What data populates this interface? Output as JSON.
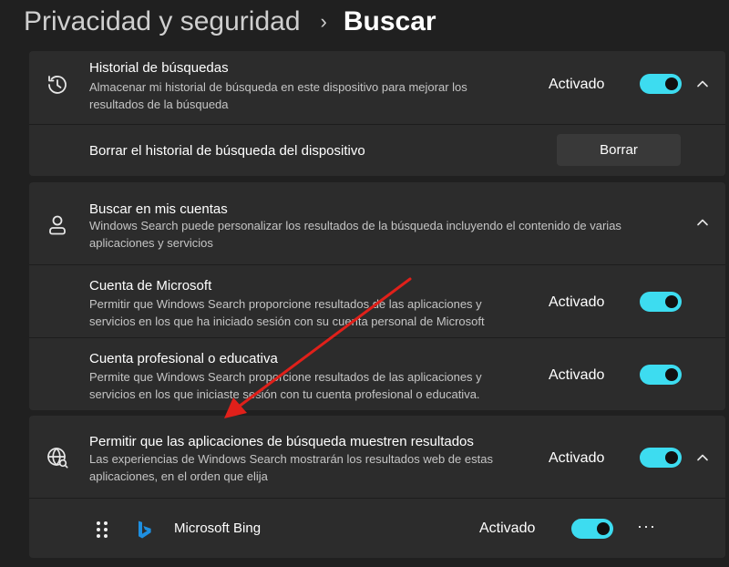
{
  "breadcrumb": {
    "parent": "Privacidad y seguridad",
    "separator": "›",
    "current": "Buscar"
  },
  "history": {
    "title": "Historial de búsquedas",
    "description": "Almacenar mi historial de búsqueda en este dispositivo para mejorar los resultados de la búsqueda",
    "state": "Activado",
    "toggle_on": true,
    "clear_label": "Borrar el historial de búsqueda del dispositivo",
    "clear_button": "Borrar"
  },
  "accounts": {
    "title": "Buscar en mis cuentas",
    "description": "Windows Search puede personalizar los resultados de la búsqueda incluyendo el contenido de varias aplicaciones y servicios",
    "microsoft": {
      "title": "Cuenta de Microsoft",
      "description": "Permitir que Windows Search proporcione resultados de las aplicaciones y servicios en los que ha iniciado sesión con su cuenta personal de Microsoft",
      "state": "Activado",
      "toggle_on": true
    },
    "work": {
      "title": "Cuenta profesional o educativa",
      "description": "Permite que Windows Search proporcione resultados de las aplicaciones y servicios en los que iniciaste sesión con tu cuenta profesional o educativa.",
      "state": "Activado",
      "toggle_on": true
    }
  },
  "search_apps": {
    "title": "Permitir que las aplicaciones de búsqueda muestren resultados",
    "description": "Las experiencias de Windows Search mostrarán los resultados web de estas aplicaciones, en el orden que elija",
    "state": "Activado",
    "toggle_on": true,
    "items": [
      {
        "name": "Microsoft Bing",
        "state": "Activado",
        "toggle_on": true,
        "more": "···"
      }
    ]
  },
  "colors": {
    "accent": "#3ddcf0",
    "background": "#202020",
    "card": "#2c2c2c",
    "arrow": "#e0201a"
  },
  "icons": [
    "history-icon",
    "person-icon",
    "globe-search-icon",
    "chevron-up-icon",
    "drag-handle-icon",
    "bing-logo-icon",
    "more-options-icon"
  ]
}
